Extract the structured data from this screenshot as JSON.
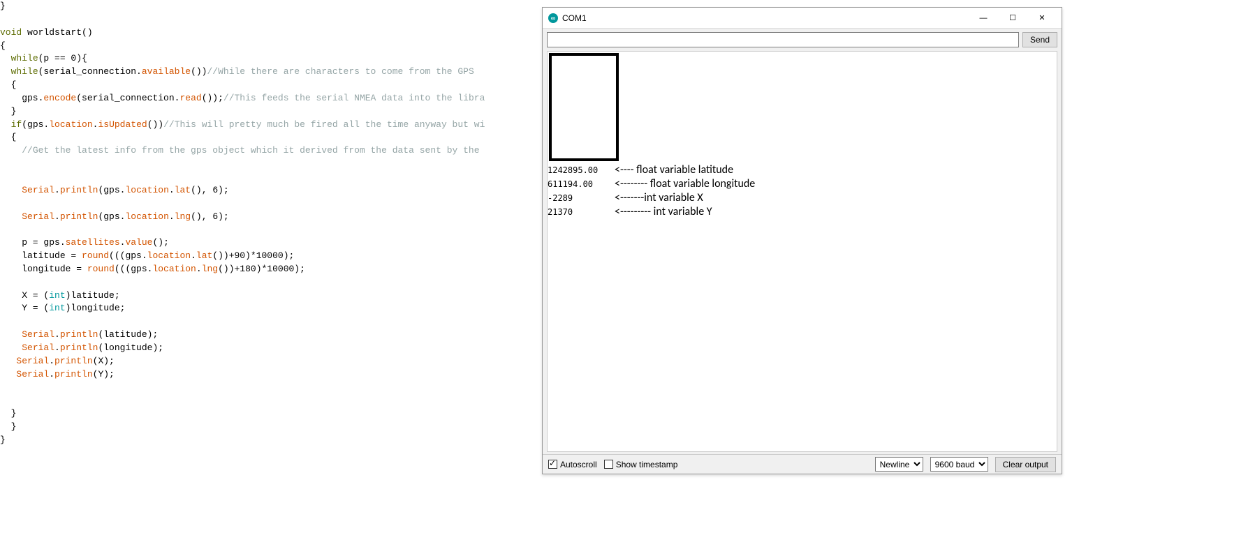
{
  "code": {
    "lines": [
      {
        "t": "txt",
        "s": "}"
      },
      {
        "t": "blank",
        "s": ""
      },
      {
        "t": "raw",
        "html": [
          [
            "kw2",
            "void"
          ],
          [
            "txt",
            " worldstart()"
          ]
        ]
      },
      {
        "t": "txt",
        "s": "{"
      },
      {
        "t": "raw",
        "html": [
          [
            "txt",
            "  "
          ],
          [
            "kw2",
            "while"
          ],
          [
            "txt",
            "(p == 0){"
          ]
        ]
      },
      {
        "t": "raw",
        "html": [
          [
            "txt",
            "  "
          ],
          [
            "kw2",
            "while"
          ],
          [
            "txt",
            "(serial_connection."
          ],
          [
            "fn",
            "available"
          ],
          [
            "txt",
            "())"
          ],
          [
            "cmt",
            "//While there are characters to come from the GPS"
          ]
        ]
      },
      {
        "t": "txt",
        "s": "  {"
      },
      {
        "t": "raw",
        "html": [
          [
            "txt",
            "    gps."
          ],
          [
            "fn",
            "encode"
          ],
          [
            "txt",
            "(serial_connection."
          ],
          [
            "fn",
            "read"
          ],
          [
            "txt",
            "());"
          ],
          [
            "cmt",
            "//This feeds the serial NMEA data into the libra"
          ]
        ]
      },
      {
        "t": "txt",
        "s": "  }"
      },
      {
        "t": "raw",
        "html": [
          [
            "txt",
            "  "
          ],
          [
            "kw2",
            "if"
          ],
          [
            "txt",
            "(gps."
          ],
          [
            "fn",
            "location"
          ],
          [
            "txt",
            "."
          ],
          [
            "fn",
            "isUpdated"
          ],
          [
            "txt",
            "())"
          ],
          [
            "cmt",
            "//This will pretty much be fired all the time anyway but wi"
          ]
        ]
      },
      {
        "t": "txt",
        "s": "  {"
      },
      {
        "t": "raw",
        "html": [
          [
            "txt",
            "    "
          ],
          [
            "cmt",
            "//Get the latest info from the gps object which it derived from the data sent by the"
          ]
        ]
      },
      {
        "t": "blank",
        "s": ""
      },
      {
        "t": "blank",
        "s": ""
      },
      {
        "t": "raw",
        "html": [
          [
            "txt",
            "    "
          ],
          [
            "kw",
            "Serial"
          ],
          [
            "txt",
            "."
          ],
          [
            "fn",
            "println"
          ],
          [
            "txt",
            "(gps."
          ],
          [
            "fn",
            "location"
          ],
          [
            "txt",
            "."
          ],
          [
            "fn",
            "lat"
          ],
          [
            "txt",
            "(), 6);"
          ]
        ]
      },
      {
        "t": "blank",
        "s": ""
      },
      {
        "t": "raw",
        "html": [
          [
            "txt",
            "    "
          ],
          [
            "kw",
            "Serial"
          ],
          [
            "txt",
            "."
          ],
          [
            "fn",
            "println"
          ],
          [
            "txt",
            "(gps."
          ],
          [
            "fn",
            "location"
          ],
          [
            "txt",
            "."
          ],
          [
            "fn",
            "lng"
          ],
          [
            "txt",
            "(), 6);"
          ]
        ]
      },
      {
        "t": "blank",
        "s": ""
      },
      {
        "t": "raw",
        "html": [
          [
            "txt",
            "    p = gps."
          ],
          [
            "fn",
            "satellites"
          ],
          [
            "txt",
            "."
          ],
          [
            "fn",
            "value"
          ],
          [
            "txt",
            "();"
          ]
        ]
      },
      {
        "t": "raw",
        "html": [
          [
            "txt",
            "    latitude = "
          ],
          [
            "fn",
            "round"
          ],
          [
            "txt",
            "(((gps."
          ],
          [
            "fn",
            "location"
          ],
          [
            "txt",
            "."
          ],
          [
            "fn",
            "lat"
          ],
          [
            "txt",
            "())+90)*10000);"
          ]
        ]
      },
      {
        "t": "raw",
        "html": [
          [
            "txt",
            "    longitude = "
          ],
          [
            "fn",
            "round"
          ],
          [
            "txt",
            "(((gps."
          ],
          [
            "fn",
            "location"
          ],
          [
            "txt",
            "."
          ],
          [
            "fn",
            "lng"
          ],
          [
            "txt",
            "())+180)*10000);"
          ]
        ]
      },
      {
        "t": "blank",
        "s": ""
      },
      {
        "t": "raw",
        "html": [
          [
            "txt",
            "    X = ("
          ],
          [
            "typ",
            "int"
          ],
          [
            "txt",
            ")latitude;"
          ]
        ]
      },
      {
        "t": "raw",
        "html": [
          [
            "txt",
            "    Y = ("
          ],
          [
            "typ",
            "int"
          ],
          [
            "txt",
            ")longitude;"
          ]
        ]
      },
      {
        "t": "blank",
        "s": ""
      },
      {
        "t": "raw",
        "html": [
          [
            "txt",
            "    "
          ],
          [
            "kw",
            "Serial"
          ],
          [
            "txt",
            "."
          ],
          [
            "fn",
            "println"
          ],
          [
            "txt",
            "(latitude);"
          ]
        ]
      },
      {
        "t": "raw",
        "html": [
          [
            "txt",
            "    "
          ],
          [
            "kw",
            "Serial"
          ],
          [
            "txt",
            "."
          ],
          [
            "fn",
            "println"
          ],
          [
            "txt",
            "(longitude);"
          ]
        ]
      },
      {
        "t": "raw",
        "html": [
          [
            "txt",
            "   "
          ],
          [
            "kw",
            "Serial"
          ],
          [
            "txt",
            "."
          ],
          [
            "fn",
            "println"
          ],
          [
            "txt",
            "(X);"
          ]
        ]
      },
      {
        "t": "raw",
        "html": [
          [
            "txt",
            "   "
          ],
          [
            "kw",
            "Serial"
          ],
          [
            "txt",
            "."
          ],
          [
            "fn",
            "println"
          ],
          [
            "txt",
            "(Y);"
          ]
        ]
      },
      {
        "t": "blank",
        "s": ""
      },
      {
        "t": "blank",
        "s": ""
      },
      {
        "t": "txt",
        "s": "  }"
      },
      {
        "t": "txt",
        "s": "  }"
      },
      {
        "t": "txt",
        "s": "}"
      }
    ]
  },
  "serial": {
    "title": "COM1",
    "send_button": "Send",
    "clear_button": "Clear output",
    "autoscroll_label": "Autoscroll",
    "timestamp_label": "Show timestamp",
    "autoscroll_checked": true,
    "timestamp_checked": false,
    "line_ending": "Newline",
    "baud": "9600 baud",
    "input_value": "",
    "output": {
      "lat_float": "1242895.00",
      "lng_float": "611194.00",
      "x_int": "-2289",
      "y_int": "21370"
    },
    "annotations": {
      "lat": "<---- float variable latitude",
      "lng": "<-------- float variable longitude",
      "x": "<-------int variable X",
      "y": "<--------- int variable Y"
    }
  }
}
